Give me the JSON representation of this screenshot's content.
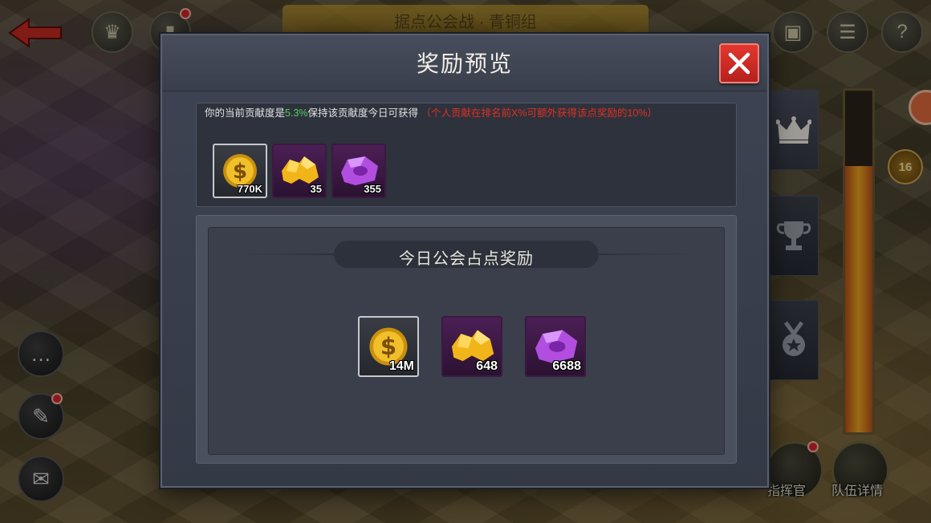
{
  "background": {
    "banner_text": "据点公会战 · 青铜组",
    "bottom_left_label": "指挥官",
    "bottom_right_label": "队伍详情",
    "level_badge": "16"
  },
  "modal": {
    "title": "奖励预览",
    "close_icon": "close-x-icon"
  },
  "personal": {
    "text_prefix": "你的当前贡献度是",
    "contribution_pct": "5.3%",
    "text_middle": "保持该贡献度今日可获得",
    "warning": "（个人贡献在排名前X%可额外获得该点奖励的10%）",
    "rewards": [
      {
        "type": "gold-coin",
        "quantity": "770K",
        "frame": "gold"
      },
      {
        "type": "gold-ore",
        "quantity": "35",
        "frame": "purple"
      },
      {
        "type": "purple-gem",
        "quantity": "355",
        "frame": "purple"
      }
    ]
  },
  "guild": {
    "title": "今日公会占点奖励",
    "rewards": [
      {
        "type": "gold-coin",
        "quantity": "14M",
        "frame": "gold"
      },
      {
        "type": "gold-ore",
        "quantity": "648",
        "frame": "purple"
      },
      {
        "type": "purple-gem",
        "quantity": "6688",
        "frame": "purple"
      }
    ]
  },
  "side_tabs": [
    "crown-icon",
    "trophy-icon",
    "medal-icon"
  ],
  "colors": {
    "accent_green": "#52d25a",
    "warning_red": "#e0301f",
    "close_red": "#d72e26"
  }
}
